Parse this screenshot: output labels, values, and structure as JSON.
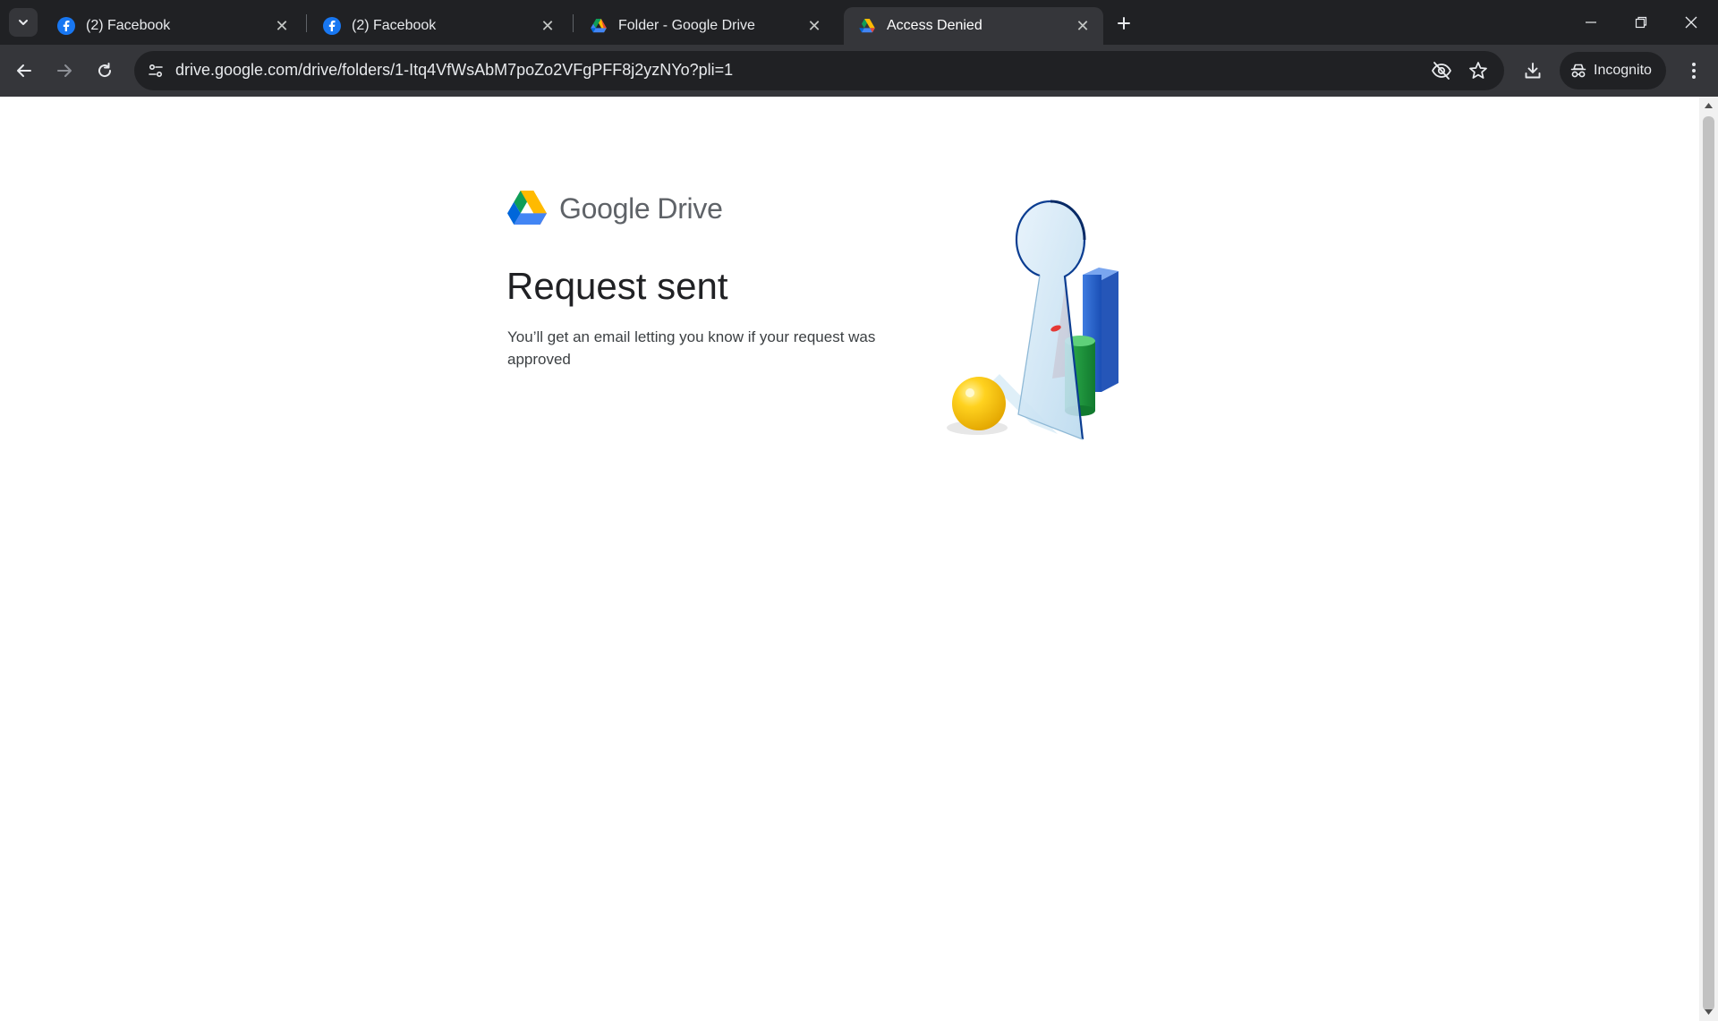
{
  "browser": {
    "tabs": [
      {
        "title": "(2) Facebook",
        "icon": "facebook-icon",
        "active": false
      },
      {
        "title": "(2) Facebook",
        "icon": "facebook-icon",
        "active": false
      },
      {
        "title": "Folder - Google Drive",
        "icon": "google-drive-icon",
        "active": false
      },
      {
        "title": "Access Denied",
        "icon": "google-drive-icon",
        "active": true
      }
    ],
    "url": "drive.google.com/drive/folders/1-Itq4VfWsAbM7poZo2VFgPFF8j2yzNYo?pli=1",
    "incognito_label": "Incognito",
    "colors": {
      "tab_strip": "#202124",
      "toolbar": "#35363a",
      "omnibox": "#202124"
    }
  },
  "page": {
    "brand": {
      "google": "Google",
      "product": "Drive"
    },
    "heading": "Request sent",
    "message": "You’ll get an email letting you know if your request was approved",
    "illustration": "keyhole-illustration"
  }
}
